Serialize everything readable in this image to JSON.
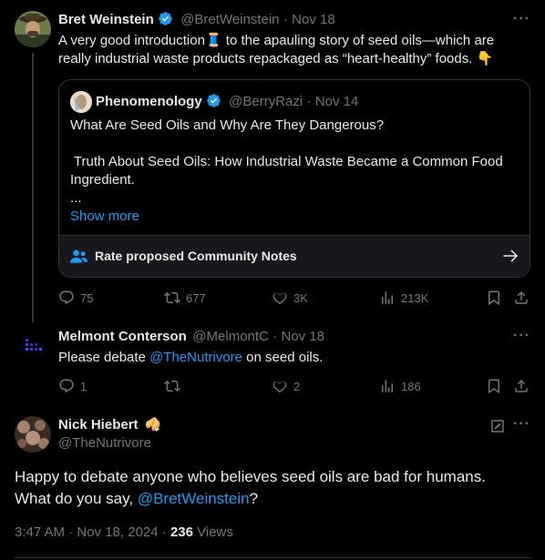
{
  "tweet1": {
    "name": "Bret Weinstein",
    "handle": "@BretWeinstein",
    "date": "· Nov 18",
    "text_a": "A very good introduction",
    "text_emoji": "🧵",
    "text_b": " to the apauling story of seed oils—which are",
    "text_line2": "really industrial waste products repackaged as “heart-healthy” foods. ",
    "text_line2_emoji": "👇",
    "stats": {
      "replies": "75",
      "reposts": "677",
      "likes": "3K",
      "views": "213K"
    }
  },
  "quote": {
    "name": "Phenomenology",
    "handle": "@BerryRazi",
    "date": "· Nov 14",
    "line1": "What Are Seed Oils and Why Are They Dangerous?",
    "line2": " Truth About Seed Oils: How Industrial Waste Became a Common Food",
    "line3": "Ingredient.",
    "ellipsis": "...",
    "show_more": "Show more",
    "community_notes": "Rate proposed Community Notes"
  },
  "tweet2": {
    "name": "Melmont Conterson",
    "handle": "@MelmontC",
    "date": "· Nov 18",
    "text_a": "Please debate ",
    "mention": "@TheNutrivore",
    "text_b": " on seed oils.",
    "stats": {
      "replies": "1",
      "reposts": "",
      "likes": "2",
      "views": "186"
    }
  },
  "main": {
    "name": "Nick Hiebert",
    "name_emoji": "🥠",
    "handle": "@TheNutrivore",
    "line1": "Happy to debate anyone who believes seed oils are bad for humans.",
    "line2_a": "What do you say, ",
    "mention": "@BretWeinstein",
    "line2_b": "?",
    "timestamp": "3:47 AM · Nov 18, 2024 · ",
    "views_count": "236",
    "views_label": " Views"
  },
  "colors": {
    "accent": "#1d9bf0",
    "muted": "#71767b",
    "background": "#000000",
    "border": "#2f3336"
  }
}
